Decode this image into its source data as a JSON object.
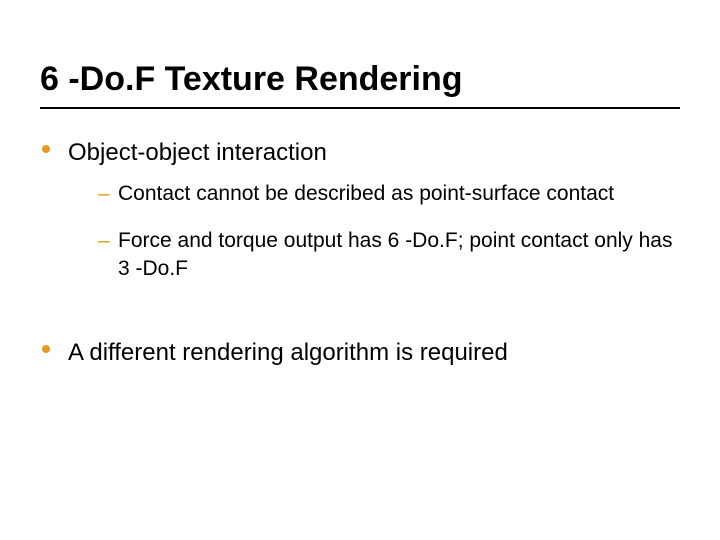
{
  "slide": {
    "title": "6 -Do.F Texture Rendering",
    "bullets": [
      {
        "text": "Object-object interaction",
        "subitems": [
          {
            "text": "Contact cannot be described as point-surface contact"
          },
          {
            "text": "Force and torque output has 6 -Do.F; point contact only has 3 -Do.F"
          }
        ]
      },
      {
        "text": "A different rendering algorithm is required",
        "subitems": []
      }
    ],
    "colors": {
      "accent": "#e69b1f"
    }
  }
}
